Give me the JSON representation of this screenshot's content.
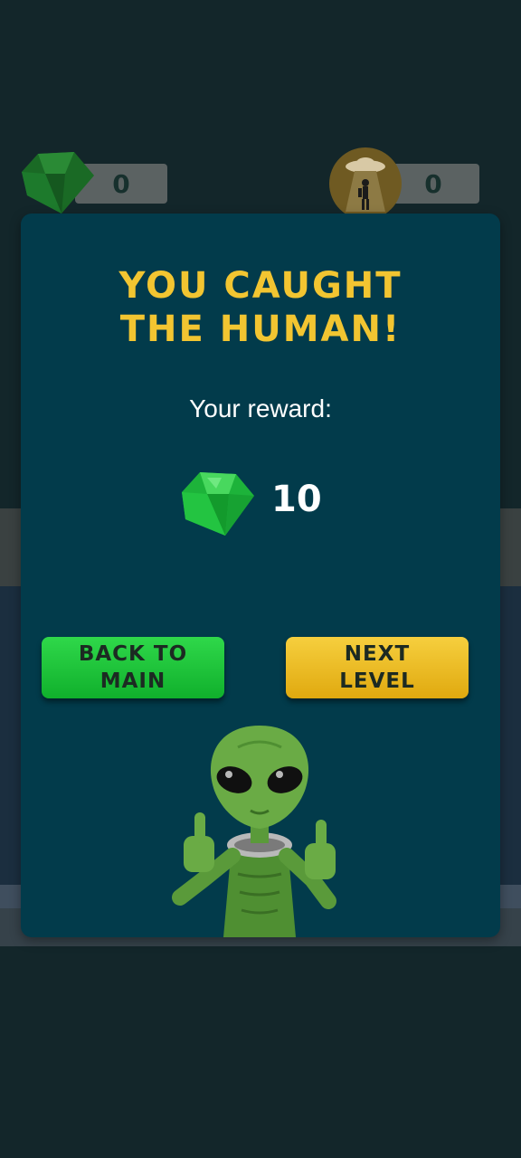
{
  "hud": {
    "gems_count": "0",
    "humans_count": "0"
  },
  "modal": {
    "title_line1": "YOU CAUGHT",
    "title_line2": "THE HUMAN!",
    "reward_label": "Your reward:",
    "reward_amount": "10",
    "back_button_line1": "BACK TO",
    "back_button_line2": "MAIN",
    "next_button_line1": "NEXT",
    "next_button_line2": "LEVEL"
  },
  "icons": {
    "gem": "gem-icon",
    "ufo": "ufo-abduction-icon",
    "alien": "alien-thumbs-up"
  },
  "colors": {
    "modal_bg": "#023b4b",
    "title": "#f2c531",
    "button_green": "#1fc53a",
    "button_yellow": "#ebbd25",
    "gem": "#1fae3a"
  }
}
